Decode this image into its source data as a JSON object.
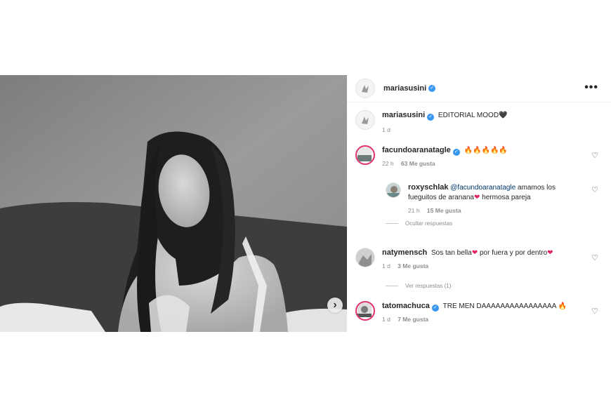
{
  "post": {
    "author": "mariasusini",
    "caption_user": "mariasusini",
    "caption_text": "EDITORIAL MOOD",
    "caption_emoji": "🖤",
    "caption_time": "1 d",
    "more_icon": "•••"
  },
  "comments": [
    {
      "user": "facundoaranatagle",
      "verified": true,
      "text": "",
      "emoji": "🔥🔥🔥🔥🔥",
      "time": "22 h",
      "likes": "63 Me gusta",
      "thread_label": "Ocultar respuestas",
      "reply": {
        "user": "roxyschlak",
        "mention": "@facundoaranatagle",
        "text_a": " amamos los fueguitos de aranana",
        "heart": "❤",
        "text_b": " hermosa pareja",
        "time": "21 h",
        "likes": "15 Me gusta"
      }
    },
    {
      "user": "natymensch",
      "text_a": "Sos tan bella",
      "heart_a": "❤",
      "text_b": " por fuera y por dentro",
      "heart_b": "❤",
      "time": "1 d",
      "likes": "3 Me gusta",
      "thread_label": "Ver respuestas (1)"
    },
    {
      "user": "tatomachuca",
      "verified": true,
      "text": "TRE MEN DAAAAAAAAAAAAAAAA",
      "emoji": "🔥",
      "time": "1 d",
      "likes": "7 Me gusta"
    }
  ],
  "icons": {
    "like": "♡",
    "next": "›",
    "verified": "✓"
  },
  "colors": {
    "verified": "#3897f0",
    "story_ring": "#e1306c",
    "heart": "#e0245e"
  }
}
